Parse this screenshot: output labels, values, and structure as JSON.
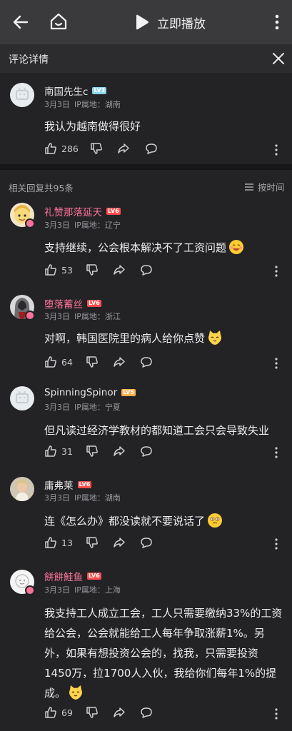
{
  "topbar": {
    "play_label": "立即播放"
  },
  "detail": {
    "title": "评论详情"
  },
  "main_comment": {
    "user": "南国先生c",
    "level": "LV3",
    "date": "3月3日",
    "ip": "IP属地：湖南",
    "text": "我认为越南做得很好",
    "likes": "286"
  },
  "replies_header": {
    "count_label": "相关回复共95条",
    "sort_label": "按时间"
  },
  "replies": [
    {
      "user": "礼赞那落延天",
      "level": "LV6",
      "date": "3月3日",
      "ip": "IP属地：辽宁",
      "text": "支持继续，公会根本解决不了工资问题",
      "likes": "53"
    },
    {
      "user": "堕落蓄丝",
      "level": "LV6",
      "date": "3月3日",
      "ip": "IP属地：浙江",
      "text": "对啊，韩国医院里的病人给你点赞",
      "likes": "64"
    },
    {
      "user": "SpinningSpinor",
      "level": "LV5",
      "date": "3月3日",
      "ip": "IP属地：宁夏",
      "text": "但凡读过经济学教材的都知道工会只会导致失业",
      "likes": "31"
    },
    {
      "user": "庸弗莱",
      "level": "LV6",
      "date": "3月3日",
      "ip": "IP属地：湖南",
      "text": "连《怎么办》都没读就不要说话了",
      "likes": "13"
    },
    {
      "user": "餅餅鮭鱼",
      "level": "LV6",
      "date": "3月3日",
      "ip": "IP属地：上海",
      "text": "我支持工人成立工会，工人只需要缴纳33%的工资给公会，公会就能给工人每年争取涨薪1%。另外，如果有想投资公会的，找我，只需要投资1450万，拉1700人入伙，我给你们每年1%的提成。",
      "likes": "69"
    }
  ],
  "colors": {
    "accent_pink": "#fb7299",
    "level6": "#ff4d4d",
    "level5": "#ffb04d",
    "level3": "#8fd3ec"
  }
}
